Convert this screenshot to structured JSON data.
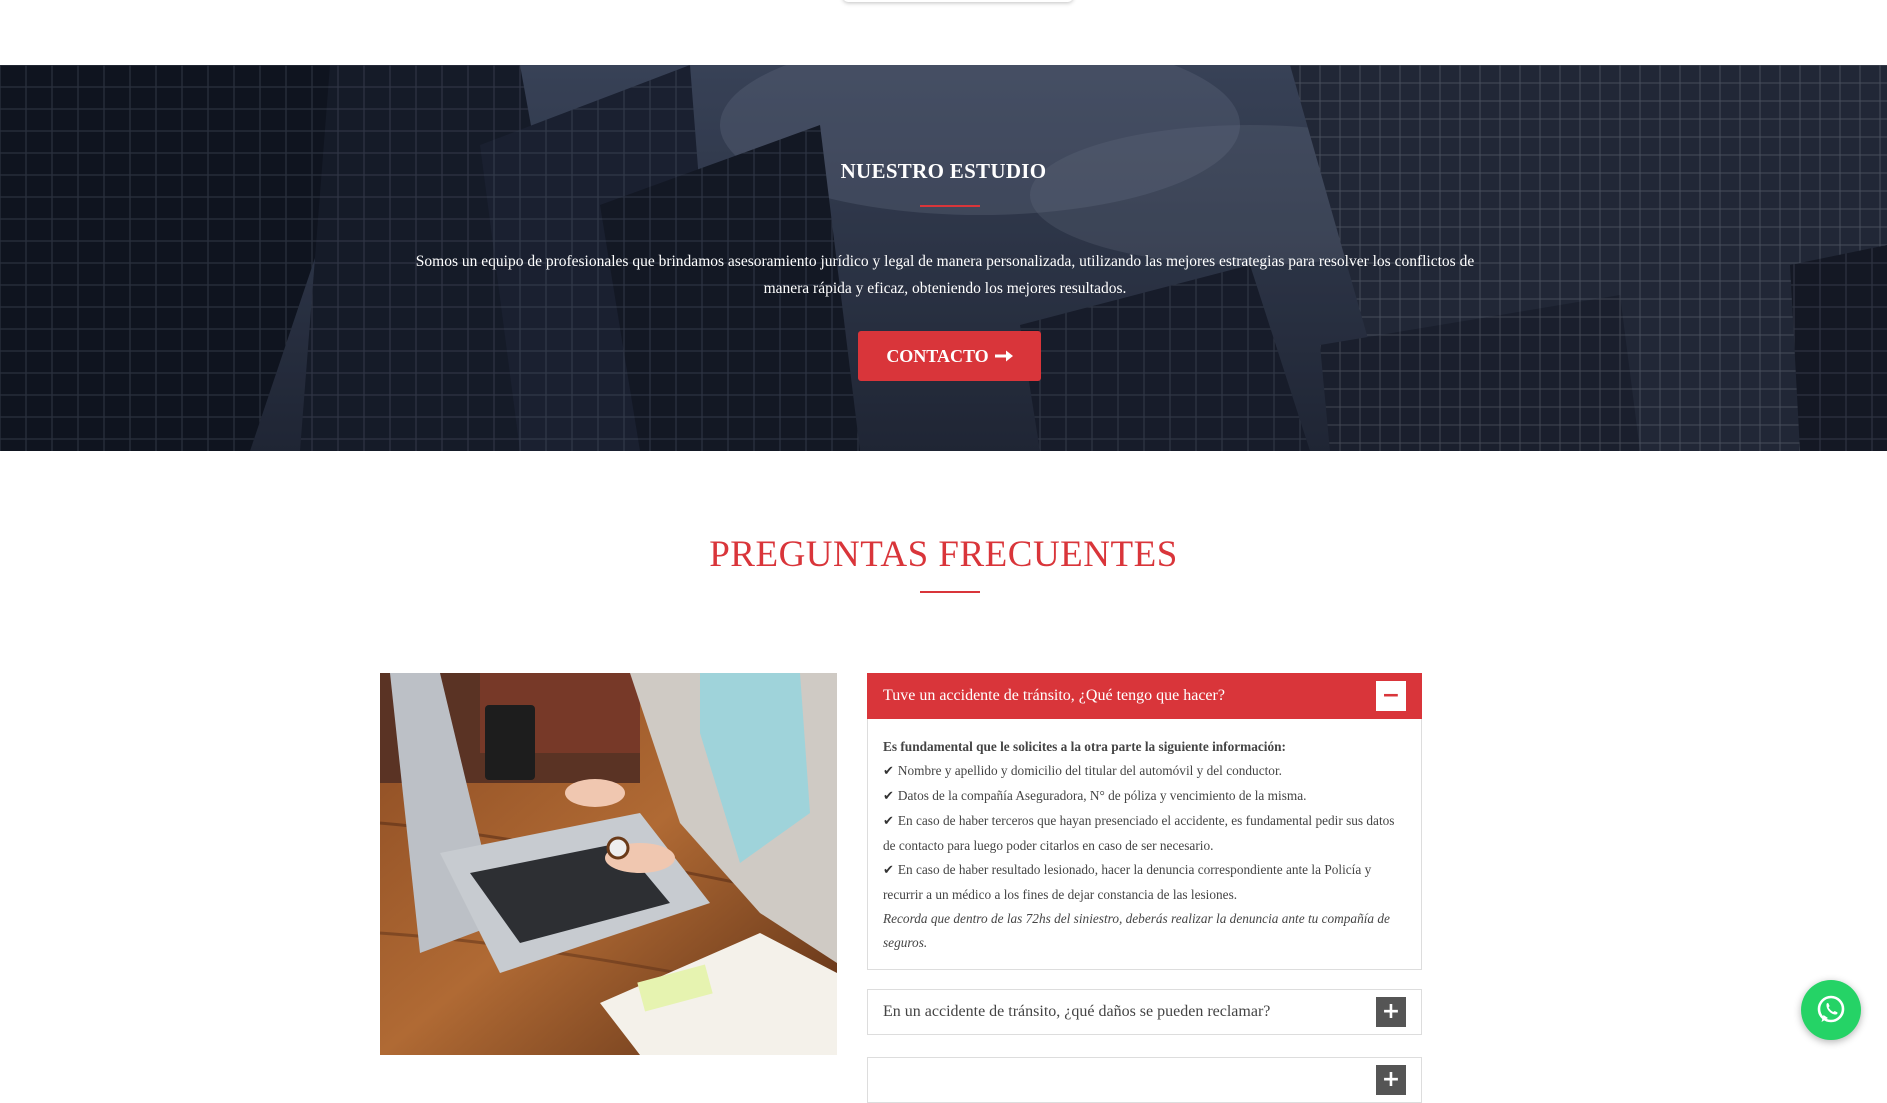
{
  "hero": {
    "title": "NUESTRO ESTUDIO",
    "text": "Somos un equipo de profesionales que brindamos asesoramiento jurídico y legal de manera personalizada, utilizando las mejores estrategias para resolver los conflictos de manera rápida y eficaz, obteniendo los mejores resultados.",
    "button_label": "CONTACTO",
    "button_icon": "arrow-right-icon",
    "accent_color": "#d9353a"
  },
  "faq": {
    "title": "PREGUNTAS FRECUENTES",
    "items": [
      {
        "question": "Tuve un accidente de tránsito, ¿Qué tengo que hacer?",
        "expanded": true,
        "toggle": "−",
        "answer": {
          "lead": "Es fundamental que le solicites a la otra parte la siguiente información:",
          "points": [
            "Nombre y apellido y domicilio del titular del automóvil y del conductor.",
            "Datos de la compañía Aseguradora, N° de póliza y vencimiento de la misma.",
            "En caso de haber terceros que hayan presenciado el accidente, es fundamental pedir sus datos de contacto para luego poder citarlos en caso de ser necesario.",
            "En caso de haber resultado lesionado, hacer la denuncia correspondiente ante la Policía y recurrir a un médico a los fines de dejar constancia de las lesiones."
          ],
          "note": "Recorda que dentro de las 72hs del siniestro, deberás realizar la denuncia ante tu compañía de seguros."
        }
      },
      {
        "question": "En un accidente de tránsito, ¿qué daños se pueden reclamar?",
        "expanded": false,
        "toggle": "+"
      },
      {
        "question": "",
        "expanded": false,
        "toggle": "+"
      }
    ]
  },
  "whatsapp": {
    "icon": "whatsapp-icon",
    "color": "#25d366"
  }
}
